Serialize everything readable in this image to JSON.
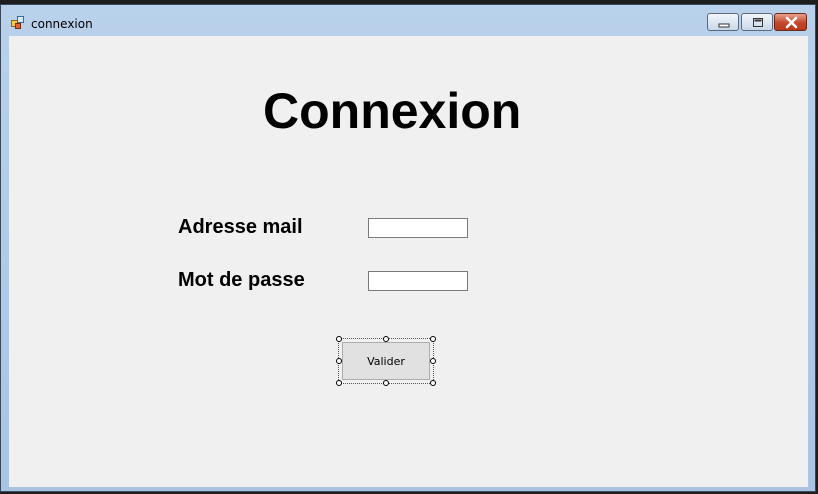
{
  "window": {
    "title": "connexion",
    "controls": {
      "minimize_icon": "minimize-icon",
      "maximize_icon": "maximize-icon",
      "close_icon": "close-icon"
    }
  },
  "form": {
    "heading": "Connexion",
    "email_label": "Adresse mail",
    "email_value": "",
    "password_label": "Mot de passe",
    "password_value": "",
    "submit_label": "Valider"
  },
  "colors": {
    "client_background": "#f0f0f0",
    "titlebar": "#b9d1ea",
    "close_button": "#c4472b"
  }
}
